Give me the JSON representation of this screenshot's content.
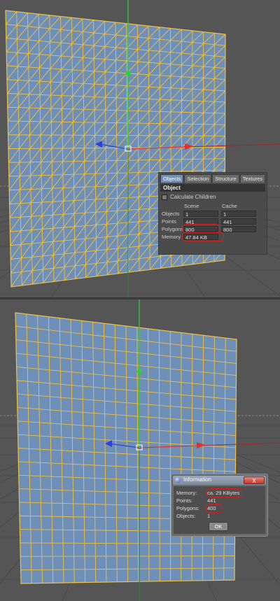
{
  "viewports": {
    "top": {
      "grid_cells": 20,
      "triangulated": true
    },
    "bottom": {
      "grid_cells": 20,
      "triangulated": false
    }
  },
  "colors": {
    "viewport_bg": "#555555",
    "plane_fill": "#6e8fb7",
    "wire": "#f0c040",
    "axis_x": "#e03030",
    "axis_y": "#30d030",
    "axis_z": "#3040e0",
    "highlight": "#cf2020"
  },
  "attr_panel": {
    "tabs": [
      "Objects",
      "Selection",
      "Structure",
      "Textures"
    ],
    "section_title": "Object",
    "calc_children_label": "Calculate Children",
    "col_scene": "Scene",
    "col_cache": "Cache",
    "rows": [
      {
        "label": "Objects",
        "scene": "1",
        "cache": "1"
      },
      {
        "label": "Points",
        "scene": "441",
        "cache": "441"
      },
      {
        "label": "Polygons",
        "scene": "800",
        "cache": "800"
      },
      {
        "label": "Memory",
        "scene": "47.84 KB",
        "cache": ""
      }
    ]
  },
  "info_dialog": {
    "title": "Information",
    "close_label": "X",
    "rows": [
      {
        "label": "Memory:",
        "value": "ca. 29 KBytes"
      },
      {
        "label": "Points:",
        "value": "441"
      },
      {
        "label": "Polygons:",
        "value": "400"
      },
      {
        "label": "Objects:",
        "value": "1"
      }
    ],
    "ok_label": "OK"
  }
}
